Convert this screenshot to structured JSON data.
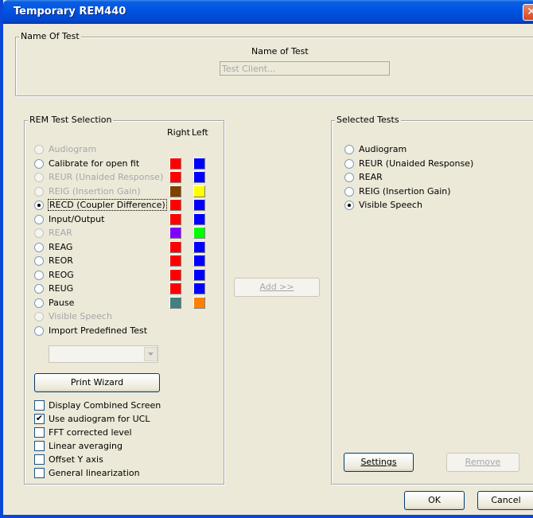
{
  "window": {
    "title": "Temporary REM440",
    "close_glyph": "✕"
  },
  "name_group": {
    "legend": "Name Of Test",
    "field_label": "Name of Test",
    "field_value": "Test Client..."
  },
  "rem_group": {
    "legend": "REM Test Selection",
    "col_right": "Right",
    "col_left": "Left",
    "tests": [
      {
        "label": "Audiogram",
        "enabled": false,
        "selected": false,
        "right": null,
        "left": null
      },
      {
        "label": "Calibrate for open fit",
        "enabled": true,
        "selected": false,
        "right": "#ff0000",
        "left": "#0000ff"
      },
      {
        "label": "REUR (Unaided Response)",
        "enabled": false,
        "selected": false,
        "right": "#ff0000",
        "left": "#0000ff"
      },
      {
        "label": "REIG (Insertion Gain)",
        "enabled": false,
        "selected": false,
        "right": "#804000",
        "left": "#ffff00"
      },
      {
        "label": "RECD (Coupler Difference)",
        "enabled": true,
        "selected": true,
        "right": "#ff0000",
        "left": "#0000ff"
      },
      {
        "label": "Input/Output",
        "enabled": true,
        "selected": false,
        "right": "#ff0000",
        "left": "#0000ff"
      },
      {
        "label": "REAR",
        "enabled": false,
        "selected": false,
        "right": "#8000ff",
        "left": "#00ff00"
      },
      {
        "label": "REAG",
        "enabled": true,
        "selected": false,
        "right": "#ff0000",
        "left": "#0000ff"
      },
      {
        "label": "REOR",
        "enabled": true,
        "selected": false,
        "right": "#ff0000",
        "left": "#0000ff"
      },
      {
        "label": "REOG",
        "enabled": true,
        "selected": false,
        "right": "#ff0000",
        "left": "#0000ff"
      },
      {
        "label": "REUG",
        "enabled": true,
        "selected": false,
        "right": "#ff0000",
        "left": "#0000ff"
      },
      {
        "label": "Pause",
        "enabled": true,
        "selected": false,
        "right": "#408080",
        "left": "#ff8000"
      },
      {
        "label": "Visible Speech",
        "enabled": false,
        "selected": false,
        "right": null,
        "left": null
      },
      {
        "label": "Import Predefined Test",
        "enabled": true,
        "selected": false,
        "right": null,
        "left": null
      }
    ],
    "dropdown_value": "",
    "print_wizard": "Print Wizard",
    "options": [
      {
        "label": "Display Combined Screen",
        "checked": false
      },
      {
        "label": "Use audiogram for UCL",
        "checked": true
      },
      {
        "label": "FFT corrected level",
        "checked": false
      },
      {
        "label": "Linear averaging",
        "checked": false
      },
      {
        "label": "Offset Y axis",
        "checked": false
      },
      {
        "label": "General linearization",
        "checked": false
      }
    ],
    "check_glyph": "✔"
  },
  "add_button": {
    "label": "Add >>"
  },
  "selected_group": {
    "legend": "Selected Tests",
    "tests": [
      {
        "label": "Audiogram",
        "selected": false
      },
      {
        "label": "REUR (Unaided Response)",
        "selected": false
      },
      {
        "label": "REAR",
        "selected": false
      },
      {
        "label": "REIG (Insertion Gain)",
        "selected": false
      },
      {
        "label": "Visible Speech",
        "selected": true
      }
    ],
    "settings": "Settings",
    "remove": "Remove"
  },
  "footer": {
    "ok": "OK",
    "cancel": "Cancel"
  }
}
